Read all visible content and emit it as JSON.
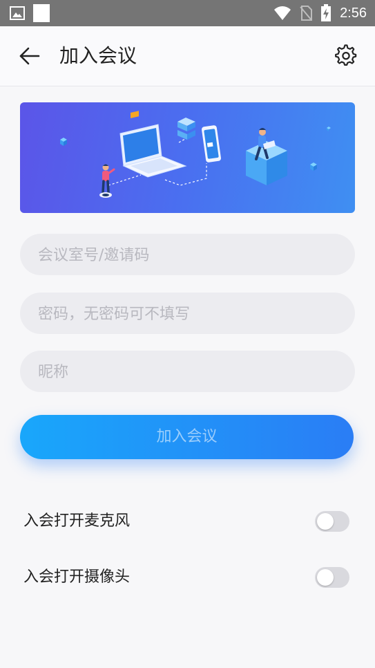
{
  "status_bar": {
    "time": "2:56",
    "icons": [
      "image-icon",
      "square-icon",
      "wifi-icon",
      "no-sim-icon",
      "battery-charging-icon"
    ]
  },
  "header": {
    "title": "加入会议",
    "back_icon": "arrow-left-icon",
    "settings_icon": "gear-icon"
  },
  "form": {
    "room_placeholder": "会议室号/邀请码",
    "password_placeholder": "密码，无密码可不填写",
    "nickname_placeholder": "昵称",
    "room_value": "",
    "password_value": "",
    "nickname_value": ""
  },
  "join_button": {
    "label": "加入会议",
    "enabled": false
  },
  "settings": [
    {
      "label": "入会打开麦克风",
      "on": false
    },
    {
      "label": "入会打开摄像头",
      "on": false
    }
  ],
  "colors": {
    "status_bar": "#757575",
    "banner_start": "#5b55e8",
    "banner_end": "#3f8ff2",
    "button_start": "#19a7fb",
    "button_end": "#2a7df5",
    "field_bg": "#ececf0"
  }
}
